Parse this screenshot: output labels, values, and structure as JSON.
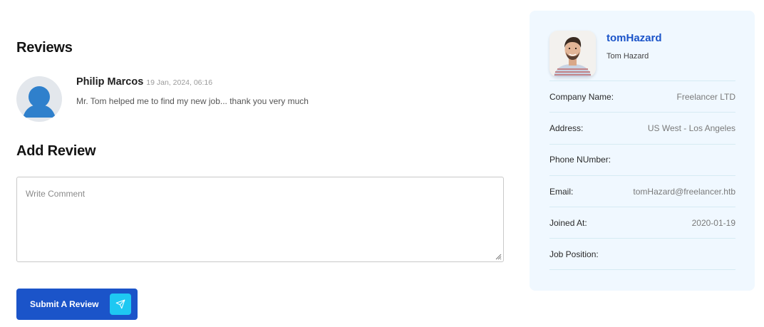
{
  "reviews": {
    "heading": "Reviews",
    "items": [
      {
        "name": "Philip Marcos",
        "date": "19 Jan, 2024, 06:16",
        "text": "Mr. Tom helped me to find my new job... thank you very much"
      }
    ]
  },
  "add_review": {
    "heading": "Add Review",
    "comment_placeholder": "Write Comment",
    "comment_value": "",
    "submit_label": "Submit A Review"
  },
  "profile": {
    "username": "tomHazard",
    "full_name": "Tom Hazard",
    "fields": [
      {
        "label": "Company Name:",
        "value": "Freelancer LTD"
      },
      {
        "label": "Address:",
        "value": "US West - Los Angeles"
      },
      {
        "label": "Phone NUmber:",
        "value": ""
      },
      {
        "label": "Email:",
        "value": "tomHazard@freelancer.htb"
      },
      {
        "label": "Joined At:",
        "value": "2020-01-19"
      },
      {
        "label": "Job Position:",
        "value": ""
      }
    ]
  },
  "icons": {
    "reviewer_avatar": "default-user-icon",
    "submit": "send-icon"
  },
  "colors": {
    "primary": "#1b54c9",
    "accent": "#1ec8f2",
    "card_bg": "#f0f8ff",
    "avatar_blue": "#2f80cc"
  }
}
